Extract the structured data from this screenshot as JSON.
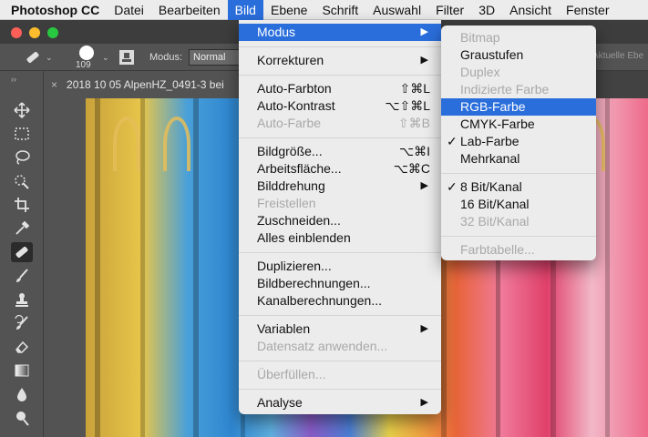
{
  "menubar": {
    "app": "Photoshop CC",
    "items": [
      "Datei",
      "Bearbeiten",
      "Bild",
      "Ebene",
      "Schrift",
      "Auswahl",
      "Filter",
      "3D",
      "Ansicht",
      "Fenster"
    ]
  },
  "options": {
    "brush_size": "109",
    "mode_label": "Modus:",
    "mode_value": "Normal",
    "ghost_text": "Aktuelle Ebe"
  },
  "document": {
    "tab_close": "×",
    "tab_title": "2018 10 05 AlpenHZ_0491-3 bei"
  },
  "bild_menu": {
    "modus": "Modus",
    "korrekturen": "Korrekturen",
    "auto_farbton": "Auto-Farbton",
    "auto_farbton_sc": "⇧⌘L",
    "auto_kontrast": "Auto-Kontrast",
    "auto_kontrast_sc": "⌥⇧⌘L",
    "auto_farbe": "Auto-Farbe",
    "auto_farbe_sc": "⇧⌘B",
    "bildgroesse": "Bildgröße...",
    "bildgroesse_sc": "⌥⌘I",
    "arbeitsflaeche": "Arbeitsfläche...",
    "arbeitsflaeche_sc": "⌥⌘C",
    "bilddrehung": "Bilddrehung",
    "freistellen": "Freistellen",
    "zuschneiden": "Zuschneiden...",
    "alles_einblenden": "Alles einblenden",
    "duplizieren": "Duplizieren...",
    "bildberechnungen": "Bildberechnungen...",
    "kanalberechnungen": "Kanalberechnungen...",
    "variablen": "Variablen",
    "datensatz": "Datensatz anwenden...",
    "ueberfuellen": "Überfüllen...",
    "analyse": "Analyse"
  },
  "modus_submenu": {
    "bitmap": "Bitmap",
    "graustufen": "Graustufen",
    "duplex": "Duplex",
    "indizierte": "Indizierte Farbe",
    "rgb": "RGB-Farbe",
    "cmyk": "CMYK-Farbe",
    "lab": "Lab-Farbe",
    "mehrkanal": "Mehrkanal",
    "bit8": "8 Bit/Kanal",
    "bit16": "16 Bit/Kanal",
    "bit32": "32 Bit/Kanal",
    "farbtabelle": "Farbtabelle..."
  },
  "icons": {
    "check": "✓",
    "submenu_arrow": "▶",
    "toolbar_chevron": "››"
  },
  "colors": {
    "accent": "#2a6edc",
    "menu_bg": "#ececec",
    "disabled_text": "#a8a8a8",
    "ps_panel": "#535353"
  }
}
